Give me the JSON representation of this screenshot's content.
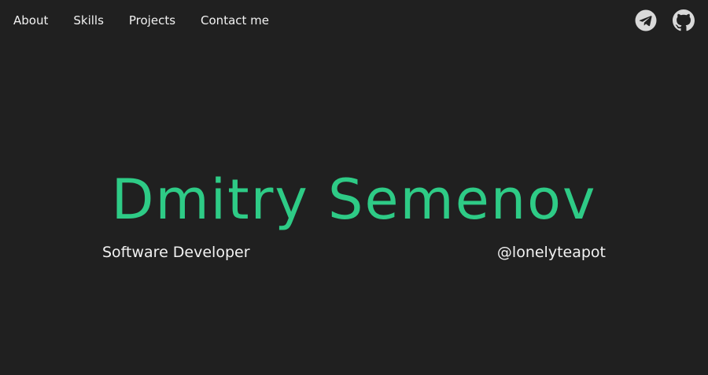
{
  "nav": {
    "items": [
      {
        "label": "About"
      },
      {
        "label": "Skills"
      },
      {
        "label": "Projects"
      },
      {
        "label": "Contact me"
      }
    ]
  },
  "social": {
    "icons": [
      "telegram-icon",
      "github-icon"
    ]
  },
  "hero": {
    "name": "Dmitry Semenov",
    "role": "Software Developer",
    "handle": "@lonelyteapot"
  },
  "colors": {
    "background": "#202020",
    "accent": "#2ecb86",
    "text": "#f2f2f2",
    "icon": "#d9d9d9"
  }
}
